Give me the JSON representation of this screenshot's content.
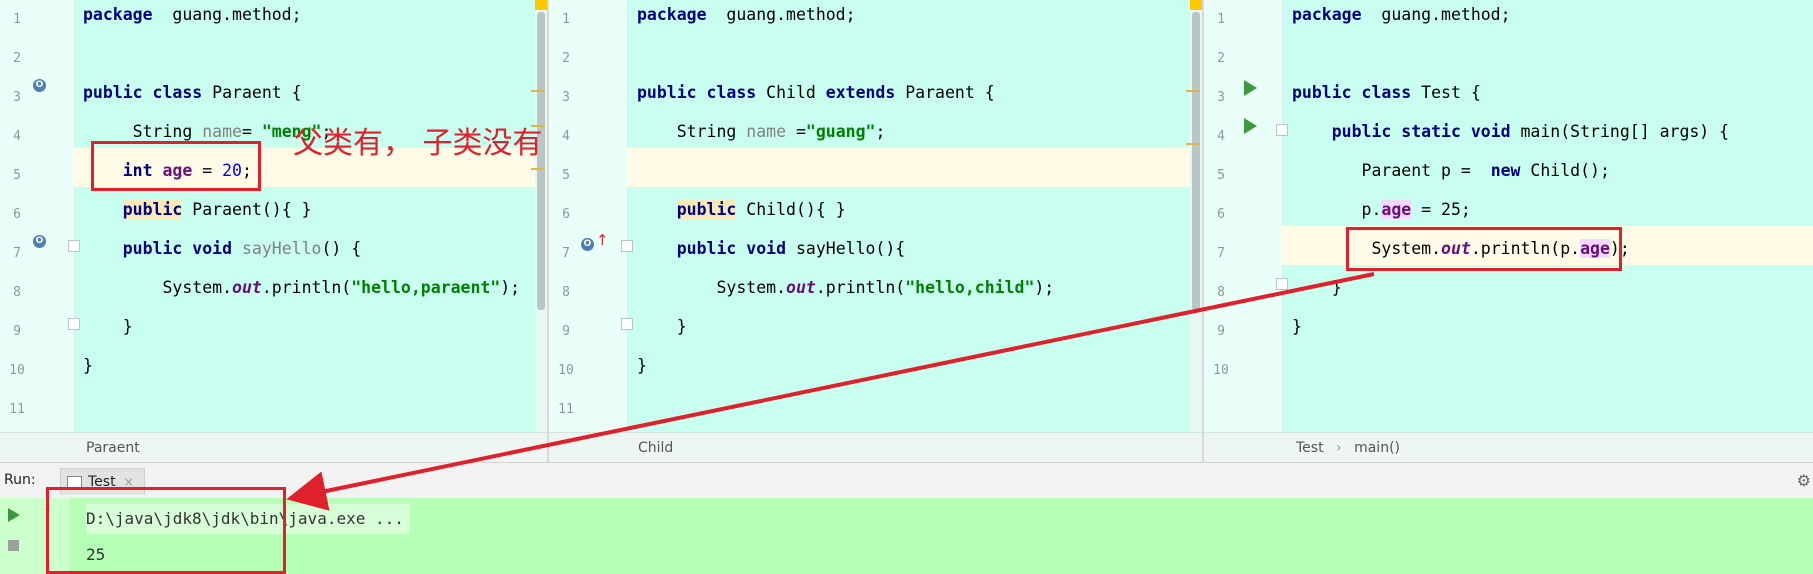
{
  "panes": [
    {
      "id": "paraent",
      "breadcrumb": [
        "Paraent"
      ],
      "lines": [
        {
          "n": "1",
          "tokens": [
            [
              "kw",
              "package"
            ],
            [
              "",
              "  guang.method;"
            ]
          ]
        },
        {
          "n": "2",
          "tokens": []
        },
        {
          "n": "3",
          "tokens": [
            [
              "kw",
              "public class"
            ],
            [
              "",
              " Paraent {"
            ]
          ]
        },
        {
          "n": "4",
          "tokens": [
            [
              "",
              "     String "
            ],
            [
              "gray",
              "name"
            ],
            [
              "",
              "= "
            ],
            [
              "str",
              "\"meng\""
            ],
            [
              "",
              ";"
            ]
          ]
        },
        {
          "n": "5",
          "tokens": [
            [
              "",
              "    "
            ],
            [
              "kw",
              "int"
            ],
            [
              "",
              " "
            ],
            [
              "fld",
              "age"
            ],
            [
              "",
              " = "
            ],
            [
              "num",
              "20"
            ],
            [
              "",
              ";"
            ]
          ]
        },
        {
          "n": "6",
          "tokens": [
            [
              "",
              "    "
            ],
            [
              "kw mark-yellow",
              "public"
            ],
            [
              "",
              " Paraent(){ }"
            ]
          ]
        },
        {
          "n": "7",
          "tokens": [
            [
              "",
              "    "
            ],
            [
              "kw",
              "public void"
            ],
            [
              "",
              " "
            ],
            [
              "gray",
              "sayHello"
            ],
            [
              "",
              "() {"
            ]
          ]
        },
        {
          "n": "8",
          "tokens": [
            [
              "",
              "        System."
            ],
            [
              "itf",
              "out"
            ],
            [
              "",
              ".println("
            ],
            [
              "str",
              "\"hello,paraent\""
            ],
            [
              "",
              ");"
            ]
          ]
        },
        {
          "n": "9",
          "tokens": [
            [
              "",
              "    }"
            ]
          ]
        },
        {
          "n": "10",
          "tokens": [
            [
              "",
              "}"
            ]
          ]
        },
        {
          "n": "11",
          "tokens": []
        }
      ]
    },
    {
      "id": "child",
      "breadcrumb": [
        "Child"
      ],
      "lines": [
        {
          "n": "1",
          "tokens": [
            [
              "kw",
              "package"
            ],
            [
              "",
              "  guang.method;"
            ]
          ]
        },
        {
          "n": "2",
          "tokens": []
        },
        {
          "n": "3",
          "tokens": [
            [
              "kw",
              "public class"
            ],
            [
              "",
              " Child "
            ],
            [
              "kw",
              "extends"
            ],
            [
              "",
              " Paraent {"
            ]
          ]
        },
        {
          "n": "4",
          "tokens": [
            [
              "",
              "    String "
            ],
            [
              "gray",
              "name"
            ],
            [
              "",
              " ="
            ],
            [
              "str",
              "\"guang\""
            ],
            [
              "",
              ";"
            ]
          ]
        },
        {
          "n": "5",
          "tokens": []
        },
        {
          "n": "6",
          "tokens": [
            [
              "",
              "    "
            ],
            [
              "kw mark-yellow",
              "public"
            ],
            [
              "",
              " Child(){ }"
            ]
          ]
        },
        {
          "n": "7",
          "tokens": [
            [
              "",
              "    "
            ],
            [
              "kw",
              "public void"
            ],
            [
              "",
              " sayHello(){"
            ]
          ]
        },
        {
          "n": "8",
          "tokens": [
            [
              "",
              "        System."
            ],
            [
              "itf",
              "out"
            ],
            [
              "",
              ".println("
            ],
            [
              "str",
              "\"hello,child\""
            ],
            [
              "",
              ");"
            ]
          ]
        },
        {
          "n": "9",
          "tokens": [
            [
              "",
              "    }"
            ]
          ]
        },
        {
          "n": "10",
          "tokens": [
            [
              "",
              "}"
            ]
          ]
        },
        {
          "n": "11",
          "tokens": []
        }
      ]
    },
    {
      "id": "test",
      "breadcrumb": [
        "Test",
        "main()"
      ],
      "breadcrumb_sep": "›",
      "lines": [
        {
          "n": "1",
          "tokens": [
            [
              "kw",
              "package"
            ],
            [
              "",
              "  guang.method;"
            ]
          ]
        },
        {
          "n": "2",
          "tokens": []
        },
        {
          "n": "3",
          "tokens": [
            [
              "kw",
              "public class"
            ],
            [
              "",
              " Test {"
            ]
          ]
        },
        {
          "n": "4",
          "tokens": [
            [
              "",
              "    "
            ],
            [
              "kw",
              "public static void"
            ],
            [
              "",
              " main(String[] args) {"
            ]
          ]
        },
        {
          "n": "5",
          "tokens": [
            [
              "",
              "       Paraent p =  "
            ],
            [
              "kw",
              "new"
            ],
            [
              "",
              " Child();"
            ]
          ]
        },
        {
          "n": "6",
          "tokens": [
            [
              "",
              "       p."
            ],
            [
              "fld mark-purple",
              "age"
            ],
            [
              "",
              " = 25;"
            ]
          ]
        },
        {
          "n": "7",
          "tokens": [
            [
              "",
              "        System."
            ],
            [
              "itf",
              "out"
            ],
            [
              "",
              ".println(p."
            ],
            [
              "fld mark-purple",
              "age"
            ],
            [
              "",
              ");"
            ]
          ]
        },
        {
          "n": "8",
          "tokens": [
            [
              "",
              "    }"
            ]
          ]
        },
        {
          "n": "9",
          "tokens": [
            [
              "",
              "}"
            ]
          ]
        },
        {
          "n": "10",
          "tokens": []
        }
      ]
    }
  ],
  "run": {
    "label": "Run:",
    "tab_label": "Test",
    "tab_close": "×",
    "gear_icon": "⚙",
    "console_lines": [
      "D:\\java\\jdk8\\jdk\\bin\\java.exe ...",
      "25"
    ]
  },
  "annotation": {
    "text": "父类有， 子类没有",
    "color": "#e0202a"
  }
}
